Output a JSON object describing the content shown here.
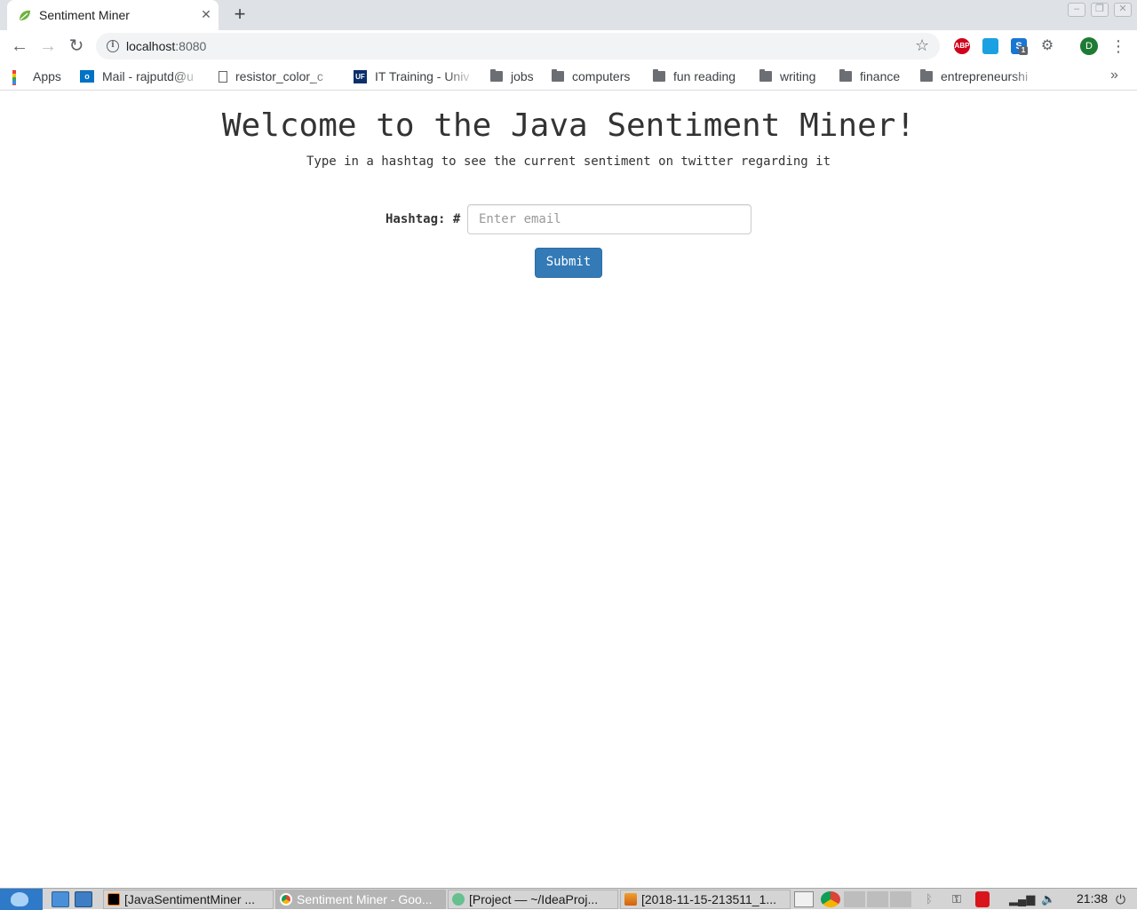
{
  "browser": {
    "tab": {
      "title": "Sentiment Miner",
      "close_icon": "✕",
      "favicon": "spring-leaf-icon"
    },
    "new_tab_label": "+",
    "nav": {
      "back": "←",
      "forward": "→",
      "reload": "↻"
    },
    "address": {
      "host": "localhost",
      "port": ":8080"
    },
    "extensions": [
      {
        "name": "adblock-plus-icon",
        "label": "ABP",
        "color": "#d0021b"
      },
      {
        "name": "picture-extension-icon",
        "label": "",
        "color": "#1ba1e2"
      },
      {
        "name": "skype-extension-icon",
        "label": "S",
        "color": "#1976d2",
        "badge": "1"
      },
      {
        "name": "settings-extension-icon",
        "label": "⚙",
        "color": "#5f6368"
      }
    ],
    "profile_initial": "D",
    "bookmarks": [
      {
        "label": "Apps",
        "icon": "apps-icon"
      },
      {
        "label": "Mail - rajputd@u",
        "icon": "outlook-icon"
      },
      {
        "label": "resistor_color_c",
        "icon": "page-icon"
      },
      {
        "label": "IT Training - Univ",
        "icon": "uf-icon"
      },
      {
        "label": "jobs",
        "icon": "folder-icon"
      },
      {
        "label": "computers",
        "icon": "folder-icon"
      },
      {
        "label": "fun reading",
        "icon": "folder-icon"
      },
      {
        "label": "writing",
        "icon": "folder-icon"
      },
      {
        "label": "finance",
        "icon": "folder-icon"
      },
      {
        "label": "entrepreneurshi",
        "icon": "folder-icon"
      }
    ],
    "bookmarks_overflow": "»"
  },
  "page": {
    "heading": "Welcome to the Java Sentiment Miner!",
    "subtitle": "Type in a hashtag to see the current sentiment on twitter regarding it",
    "form": {
      "label": "Hashtag: #",
      "input_value": "",
      "input_placeholder": "Enter email",
      "submit_label": "Submit"
    },
    "colors": {
      "primary_button": "#337ab7",
      "text": "#333333"
    }
  },
  "taskbar": {
    "tasks": [
      {
        "label": "[JavaSentimentMiner ...",
        "icon": "intellij-icon",
        "active": false
      },
      {
        "label": "Sentiment Miner - Goo...",
        "icon": "chrome-icon",
        "active": true
      },
      {
        "label": "[Project — ~/IdeaProj...",
        "icon": "atom-icon",
        "active": false
      },
      {
        "label": "[2018-11-15-213511_1...",
        "icon": "image-viewer-icon",
        "active": false
      }
    ],
    "clock": "21:38"
  }
}
